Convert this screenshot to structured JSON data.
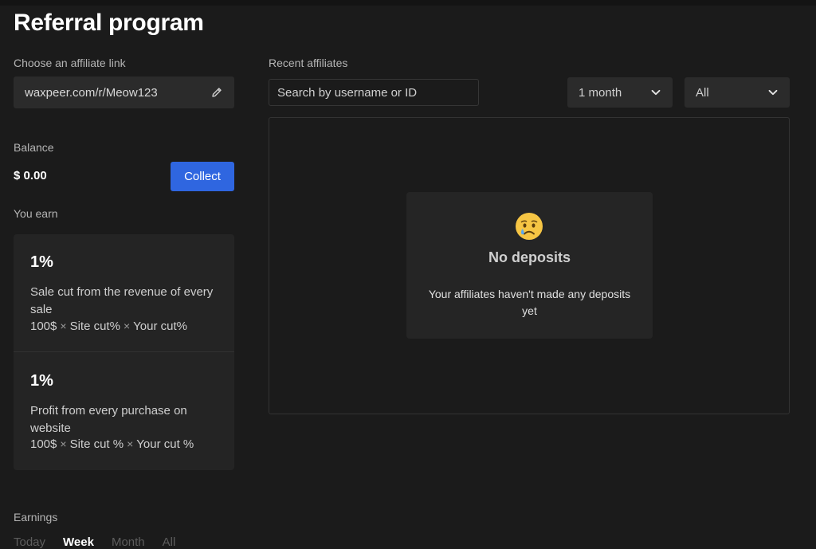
{
  "page": {
    "title": "Referral program"
  },
  "affiliate_link": {
    "label": "Choose an affiliate link",
    "value": "waxpeer.com/r/Meow123",
    "edit_icon": "pencil-icon"
  },
  "balance": {
    "label": "Balance",
    "value": "$ 0.00",
    "collect_label": "Collect"
  },
  "earn": {
    "label": "You earn",
    "items": [
      {
        "percent": "1%",
        "description": "Sale cut from the revenue of every sale",
        "formula": [
          "100$",
          "Site cut%",
          "Your cut%"
        ]
      },
      {
        "percent": "1%",
        "description": "Profit from every purchase on website",
        "formula": [
          "100$",
          "Site cut %",
          "Your cut %"
        ]
      }
    ],
    "times_symbol": "×"
  },
  "affiliates": {
    "label": "Recent affiliates",
    "search_placeholder": "Search by username or ID",
    "period_value": "1 month",
    "filter_value": "All",
    "empty": {
      "icon": "sad-tear-emoji-icon",
      "title": "No deposits",
      "text": "Your affiliates haven't made any deposits yet"
    }
  },
  "earnings": {
    "label": "Earnings",
    "tabs": [
      "Today",
      "Week",
      "Month",
      "All"
    ],
    "active_tab": "Week"
  },
  "colors": {
    "background": "#1b1b1b",
    "card": "#242424",
    "accent_button": "#2f66e0"
  }
}
